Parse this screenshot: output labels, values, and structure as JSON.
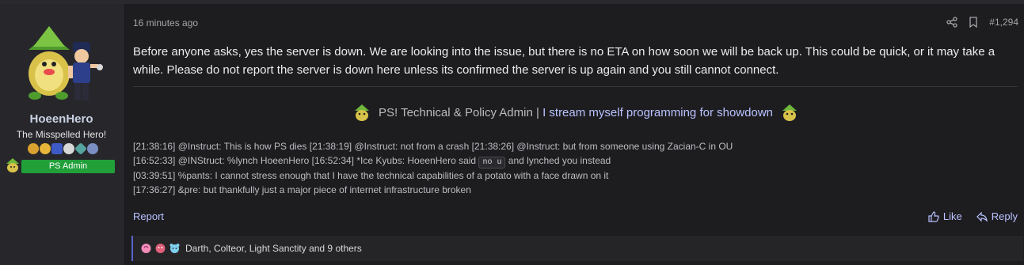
{
  "user": {
    "name": "HoeenHero",
    "title": "The Misspelled Hero!",
    "role_banner": "PS Admin",
    "badges": [
      "#d9a12f",
      "#e6b53a",
      "#3e5ac7",
      "#d8d8d8",
      "#56a4a0",
      "#7b8fc2"
    ],
    "avatar_icon": "trainer-with-pokemon-avatar",
    "sprite_icon": "pokemon-mini-sprite"
  },
  "post": {
    "time": "16 minutes ago",
    "number": "#1,294",
    "body": "Before anyone asks, yes the server is down. We are looking into the issue, but there is no ETA on how soon we will be back up. This could be quick, or it may take a while. Please do not report the server is down here unless its confirmed the server is up again and you still cannot connect.",
    "signature": {
      "text": "PS! Technical & Policy Admin | ",
      "link": "I stream myself programming for showdown"
    },
    "chat_lines": [
      {
        "a": "[21:38:16] @Instruct: This is how PS dies [21:38:19] @Instruct: not from a crash [21:38:26] @Instruct: but from someone using Zacian-C in OU",
        "kbd": "",
        "b": ""
      },
      {
        "a": "[16:52:33] @INStruct: %lynch HoeenHero [16:52:34] *Ice Kyubs: HoeenHero said ",
        "kbd": "no u",
        "b": " and lynched you instead"
      },
      {
        "a": "[03:39:51] %pants: I cannot stress enough that I have the technical capabilities of a potato with a face drawn on it",
        "kbd": "",
        "b": ""
      },
      {
        "a": "[17:36:27] &pre: but thankfully just a major piece of internet infrastructure broken",
        "kbd": "",
        "b": ""
      }
    ],
    "report": "Report",
    "like": "Like",
    "reply": "Reply",
    "reactions_text": "Darth, Colteor, Light Sanctity and 9 others"
  },
  "colors": {
    "accent": "#b9c2ff",
    "role_green": "#21a03a",
    "background": "#1d1d20"
  }
}
